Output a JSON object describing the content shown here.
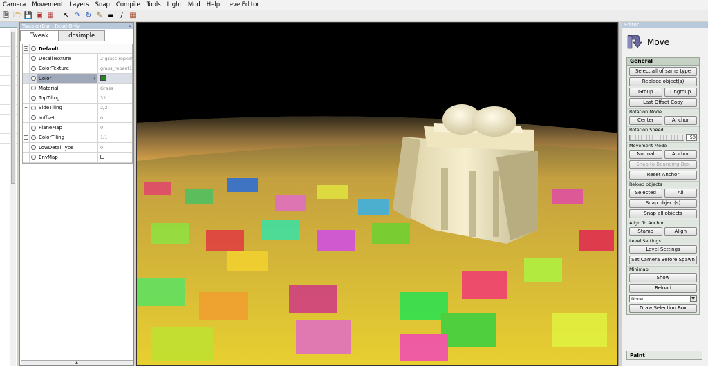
{
  "menubar": [
    "Camera",
    "Movement",
    "Layers",
    "Snap",
    "Compile",
    "Tools",
    "Light",
    "Mod",
    "Help",
    "LevelEditor"
  ],
  "toolbar": [
    "new-icon",
    "open-icon",
    "save-icon",
    "import-icon",
    "export-icon",
    "select-icon",
    "move-icon",
    "rotate-icon",
    "brush-icon",
    "line-icon",
    "eraser-icon",
    "grid-icon"
  ],
  "tweaker": {
    "title": "TweakerBar - Read Only",
    "tabs": [
      "Tweak",
      "dcsimple"
    ],
    "group_label": "Default",
    "properties": [
      {
        "name": "DetailTexture",
        "value": "2-grass-repeat"
      },
      {
        "name": "ColorTexture",
        "value": "grass_repeat1_"
      },
      {
        "name": "Color",
        "value": ""
      },
      {
        "name": "Material",
        "value": "Grass"
      },
      {
        "name": "TopTiling",
        "value": "32"
      },
      {
        "name": "SideTiling",
        "value": "2/2"
      },
      {
        "name": "Yoffset",
        "value": "0"
      },
      {
        "name": "PlaneMap",
        "value": "0"
      },
      {
        "name": "ColorTiling",
        "value": "1/1"
      },
      {
        "name": "LowDetailType",
        "value": "0"
      },
      {
        "name": "EnvMap",
        "value": ""
      }
    ],
    "color_swatch": "#1e8a1e"
  },
  "editor": {
    "title": "Editor",
    "mode_label": "Move",
    "general_label": "General",
    "buttons": {
      "select_same": "Select all of same type",
      "replace": "Replace object(s)",
      "group": "Group",
      "ungroup": "Ungroup",
      "last_offset": "Last Offset Copy",
      "center": "Center",
      "anchor": "Anchor",
      "normal": "Normal",
      "anchor2": "Anchor",
      "snap_bbox": "Snap to Bounding Box",
      "reset_anchor": "Reset Anchor",
      "selected": "Selected",
      "all": "All",
      "snap_objects": "Snap object(s)",
      "snap_all": "Snap all objects",
      "stamp": "Stamp",
      "align": "Align",
      "level_settings": "Level Settings",
      "set_camera": "Set Camera Before Spawn",
      "show": "Show",
      "reload": "Reload",
      "draw_selection": "Draw Selection Box"
    },
    "sections": {
      "rotation_mode": "Rotation Mode",
      "rotation_speed": "Rotation Speed",
      "movement_mode": "Movement Mode",
      "reload_objects": "Reload objects",
      "align_to_anchor": "Align To Anchor",
      "level_settings": "Level Settings",
      "minimap": "Minimap"
    },
    "rotation_speed_value": "50",
    "dropdown_value": "None",
    "paint_label": "Paint"
  },
  "colors": {
    "accent": "#b9c9dc",
    "panel": "#e4e9e4",
    "selected": "#9fa8b8"
  }
}
